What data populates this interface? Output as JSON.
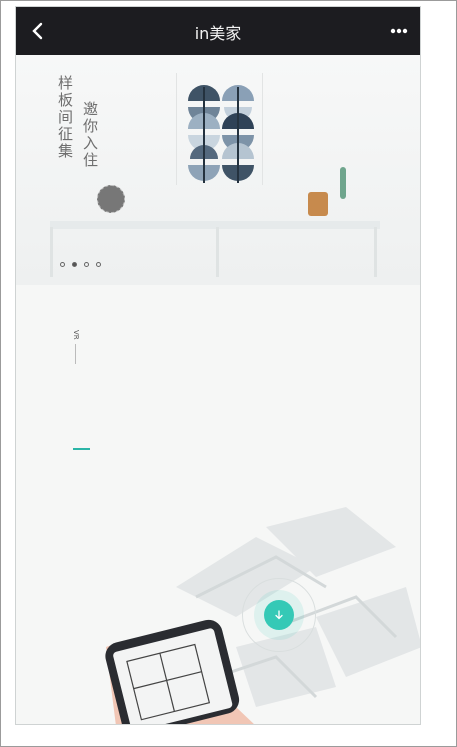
{
  "navbar": {
    "title": "in美家"
  },
  "banner": {
    "headline": "样板间征集",
    "subline": "邀你入住"
  },
  "carousel": {
    "dot_count": 4,
    "active_index": 1
  },
  "side_label": "VR",
  "colors": {
    "navbar_bg": "#1c1c20",
    "accent_teal": "#35c9b6",
    "page_bg": "#f6f7f6"
  }
}
